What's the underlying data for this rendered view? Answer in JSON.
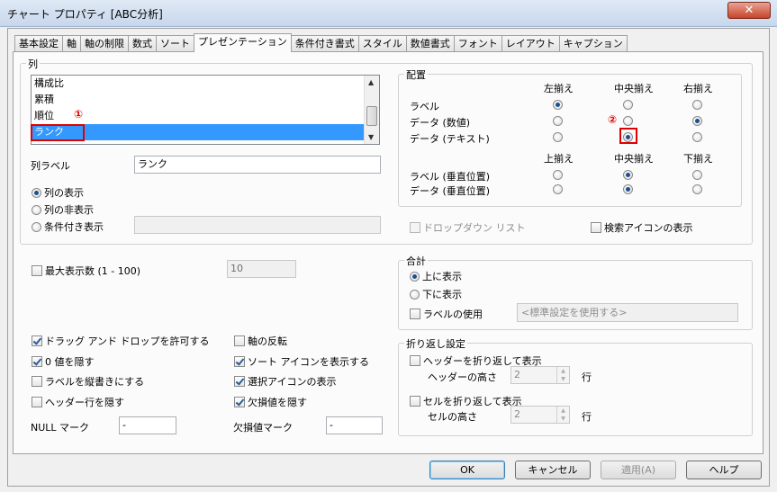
{
  "window": {
    "title": "チャート プロパティ [ABC分析]",
    "close_label": "✕"
  },
  "tabs": [
    "基本設定",
    "軸",
    "軸の制限",
    "数式",
    "ソート",
    "プレゼンテーション",
    "条件付き書式",
    "スタイル",
    "数値書式",
    "フォント",
    "レイアウト",
    "キャプション"
  ],
  "active_tab": 5,
  "column_group": {
    "title": "列",
    "list_items": [
      "構成比",
      "累積",
      "順位",
      "ランク"
    ],
    "selected_index": 3,
    "column_label": "列ラベル",
    "column_label_value": "ランク",
    "display_options": [
      "列の表示",
      "列の非表示",
      "条件付き表示"
    ],
    "display_selected": 0,
    "annotation_1": "①"
  },
  "alignment": {
    "title": "配置",
    "horizontal_headers": [
      "左揃え",
      "中央揃え",
      "右揃え"
    ],
    "horizontal_rows": [
      {
        "label": "ラベル",
        "selected": 0
      },
      {
        "label": "データ (数値)",
        "selected": 2
      },
      {
        "label": "データ (テキスト)",
        "selected": 1
      }
    ],
    "vertical_headers": [
      "上揃え",
      "中央揃え",
      "下揃え"
    ],
    "vertical_rows": [
      {
        "label": "ラベル (垂直位置)",
        "selected": 1
      },
      {
        "label": "データ (垂直位置)",
        "selected": 1
      }
    ],
    "annotation_2": "②"
  },
  "dropdown_list": {
    "label": "ドロップダウン リスト",
    "checked": false,
    "enabled": false
  },
  "search_icon": {
    "label": "検索アイコンの表示",
    "checked": false
  },
  "max_display": {
    "label": "最大表示数 (1 - 100)",
    "checked": false,
    "value": "10"
  },
  "totals": {
    "title": "合計",
    "options": [
      "上に表示",
      "下に表示"
    ],
    "selected": 0,
    "use_label": "ラベルの使用",
    "use_label_checked": false,
    "label_placeholder": "<標準設定を使用する>"
  },
  "options_left": [
    {
      "label": "ドラッグ アンド ドロップを許可する",
      "checked": true
    },
    {
      "label": "0 値を隠す",
      "checked": true
    },
    {
      "label": "ラベルを縦書きにする",
      "checked": false
    },
    {
      "label": "ヘッダー行を隠す",
      "checked": false
    }
  ],
  "options_right": [
    {
      "label": "軸の反転",
      "checked": false
    },
    {
      "label": "ソート アイコンを表示する",
      "checked": true
    },
    {
      "label": "選択アイコンの表示",
      "checked": true
    },
    {
      "label": "欠損値を隠す",
      "checked": true
    }
  ],
  "null_mark": {
    "label": "NULL マーク",
    "value": "-"
  },
  "missing_mark": {
    "label": "欠損値マーク",
    "value": "-"
  },
  "wrap": {
    "title": "折り返し設定",
    "header_wrap": "ヘッダーを折り返して表示",
    "header_wrap_checked": false,
    "header_height_label": "ヘッダーの高さ",
    "header_height": "2",
    "cell_wrap": "セルを折り返して表示",
    "cell_wrap_checked": false,
    "cell_height_label": "セルの高さ",
    "cell_height": "2",
    "unit": "行"
  },
  "buttons": {
    "ok": "OK",
    "cancel": "キャンセル",
    "apply": "適用(A)",
    "help": "ヘルプ"
  }
}
